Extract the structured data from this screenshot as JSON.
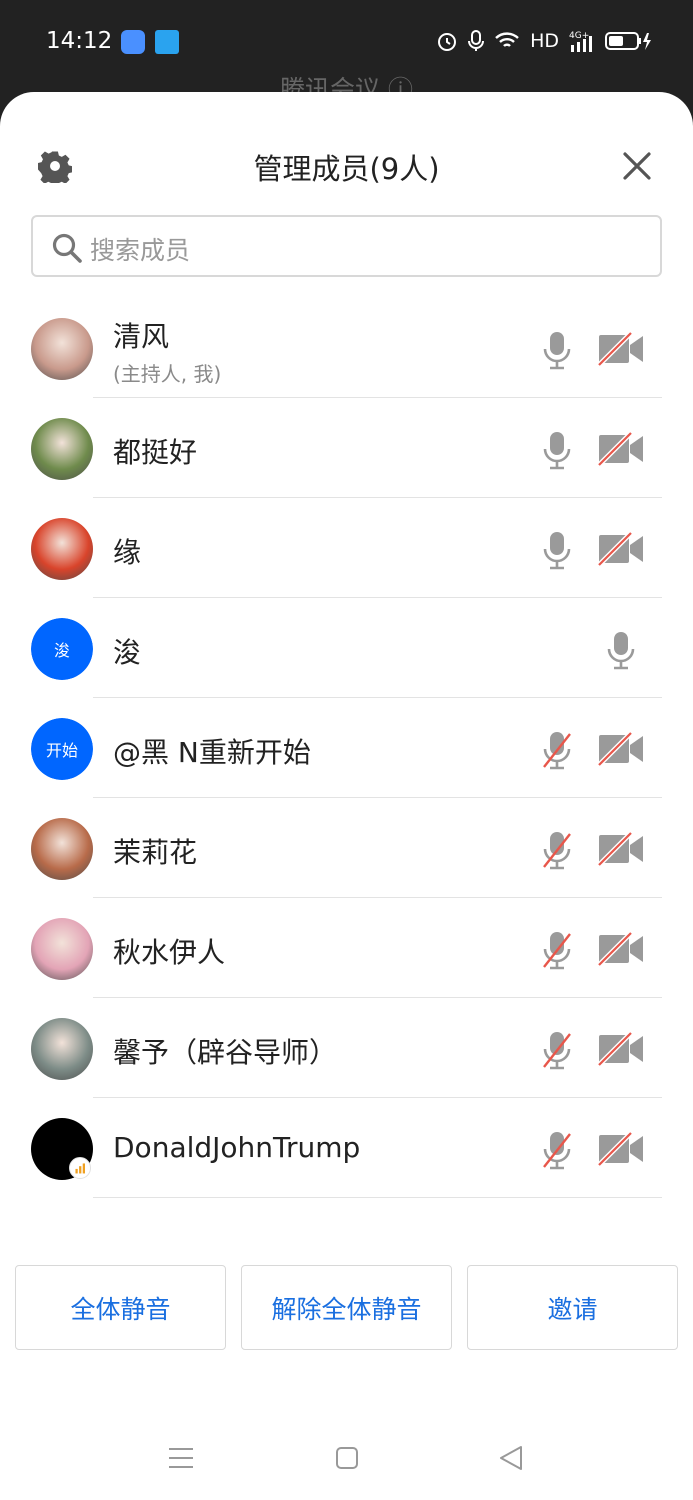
{
  "status_bar": {
    "time": "14:12",
    "network_label": "HD",
    "signal_label": "4G+"
  },
  "background_app": {
    "title": "腾讯会议 ⓘ"
  },
  "sheet": {
    "title": "管理成员(9人)",
    "search": {
      "placeholder": "搜索成员"
    }
  },
  "members": [
    {
      "name": "清风",
      "sub": "(主持人, 我)",
      "avatar_type": "photo",
      "avatar_color": "#c99a8c",
      "mic": "on",
      "camera": "off"
    },
    {
      "name": "都挺好",
      "avatar_type": "photo",
      "avatar_color": "#6f8b4c",
      "mic": "on",
      "camera": "off"
    },
    {
      "name": "缘",
      "avatar_type": "photo",
      "avatar_color": "#d9442b",
      "mic": "on",
      "camera": "off"
    },
    {
      "name": "浚",
      "avatar_type": "text",
      "avatar_text": "浚",
      "avatar_color": "#0066ff",
      "mic": "on",
      "camera": "none"
    },
    {
      "name": "@黑 N重新开始",
      "avatar_type": "text",
      "avatar_text": "开始",
      "avatar_color": "#0066ff",
      "mic": "off",
      "camera": "off"
    },
    {
      "name": "茉莉花",
      "avatar_type": "photo",
      "avatar_color": "#b86b4a",
      "mic": "off",
      "camera": "off"
    },
    {
      "name": "秋水伊人",
      "avatar_type": "photo",
      "avatar_color": "#e3a4b6",
      "mic": "off",
      "camera": "off"
    },
    {
      "name": "馨予（辟谷导师）",
      "avatar_type": "photo",
      "avatar_color": "#7d8c87",
      "mic": "off",
      "camera": "off"
    },
    {
      "name": "DonaldJohnTrump",
      "avatar_type": "photo",
      "avatar_color": "#000000",
      "mic": "off",
      "camera": "off",
      "network_badge": true
    }
  ],
  "footer": {
    "mute_all": "全体静音",
    "unmute_all": "解除全体静音",
    "invite": "邀请"
  },
  "colors": {
    "accent": "#1a6fe0",
    "avatar_blue": "#0066ff",
    "muted_red": "#e8574b",
    "icon_gray": "#9a9a9a"
  }
}
